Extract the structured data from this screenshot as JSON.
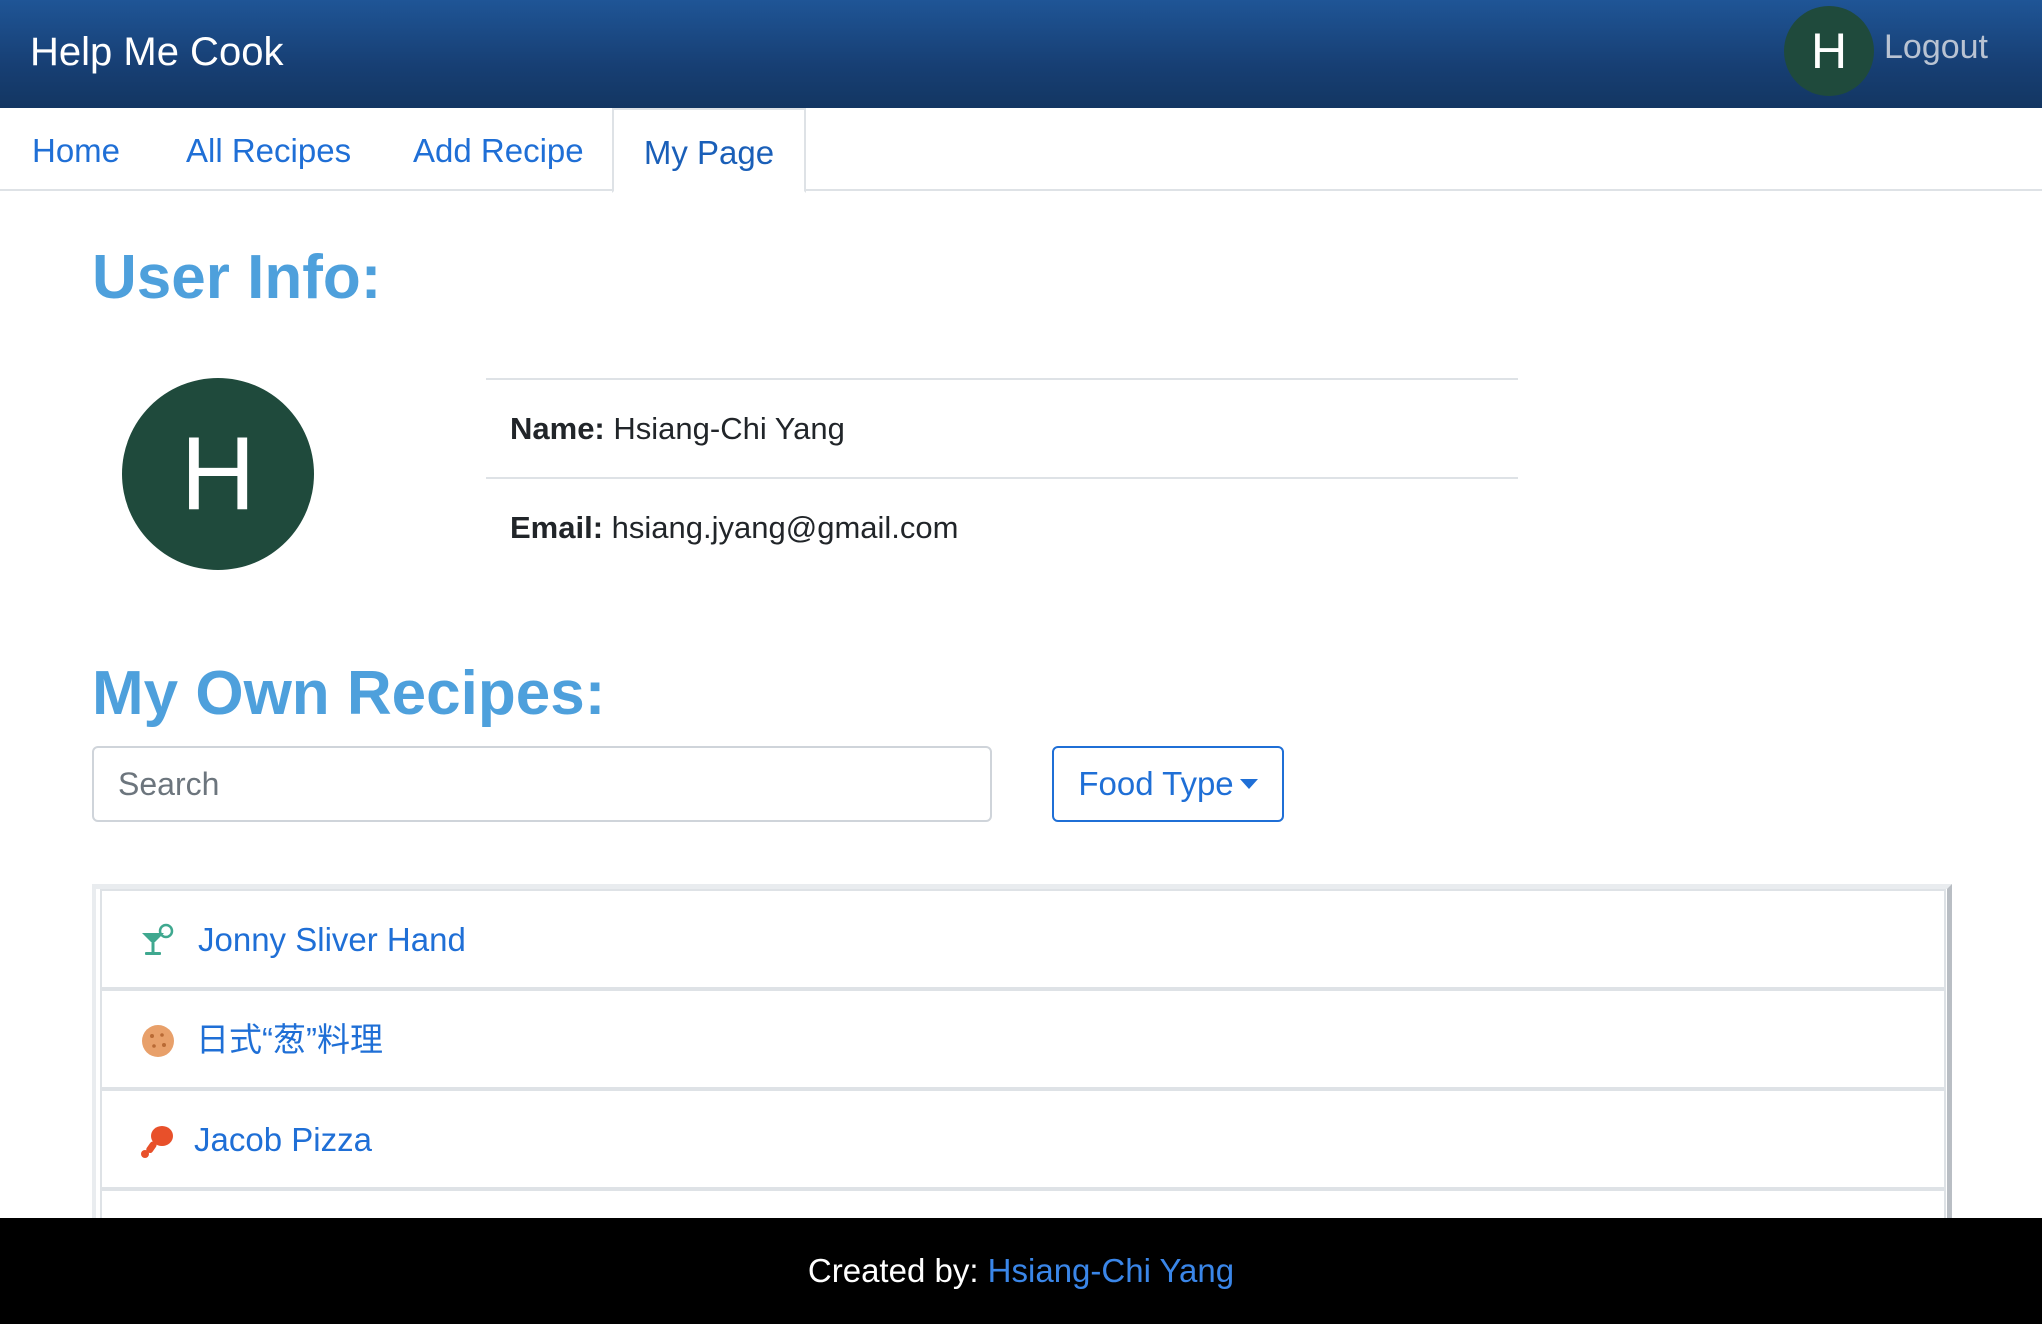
{
  "header": {
    "brand": "Help Me Cook",
    "avatar_initial": "H",
    "logout_label": "Logout"
  },
  "tabs": [
    {
      "label": "Home",
      "active": false
    },
    {
      "label": "All Recipes",
      "active": false
    },
    {
      "label": "Add Recipe",
      "active": false
    },
    {
      "label": "My Page",
      "active": true
    }
  ],
  "user_info": {
    "heading": "User Info:",
    "avatar_initial": "H",
    "name_label": "Name:",
    "name_value": "Hsiang-Chi Yang",
    "email_label": "Email:",
    "email_value": "hsiang.jyang@gmail.com"
  },
  "recipes_section": {
    "heading": "My Own Recipes:",
    "search_placeholder": "Search",
    "filter_label": "Food Type",
    "items": [
      {
        "name": "Jonny Sliver Hand",
        "icon": "cocktail-icon",
        "color": "#3fa88f"
      },
      {
        "name": "日式“葱”料理",
        "icon": "cookie-icon",
        "color": "#e8a06a"
      },
      {
        "name": "Jacob Pizza",
        "icon": "drumstick-icon",
        "color": "#e8502a"
      }
    ]
  },
  "footer": {
    "prefix": "Created by:",
    "author": "Hsiang-Chi Yang"
  }
}
